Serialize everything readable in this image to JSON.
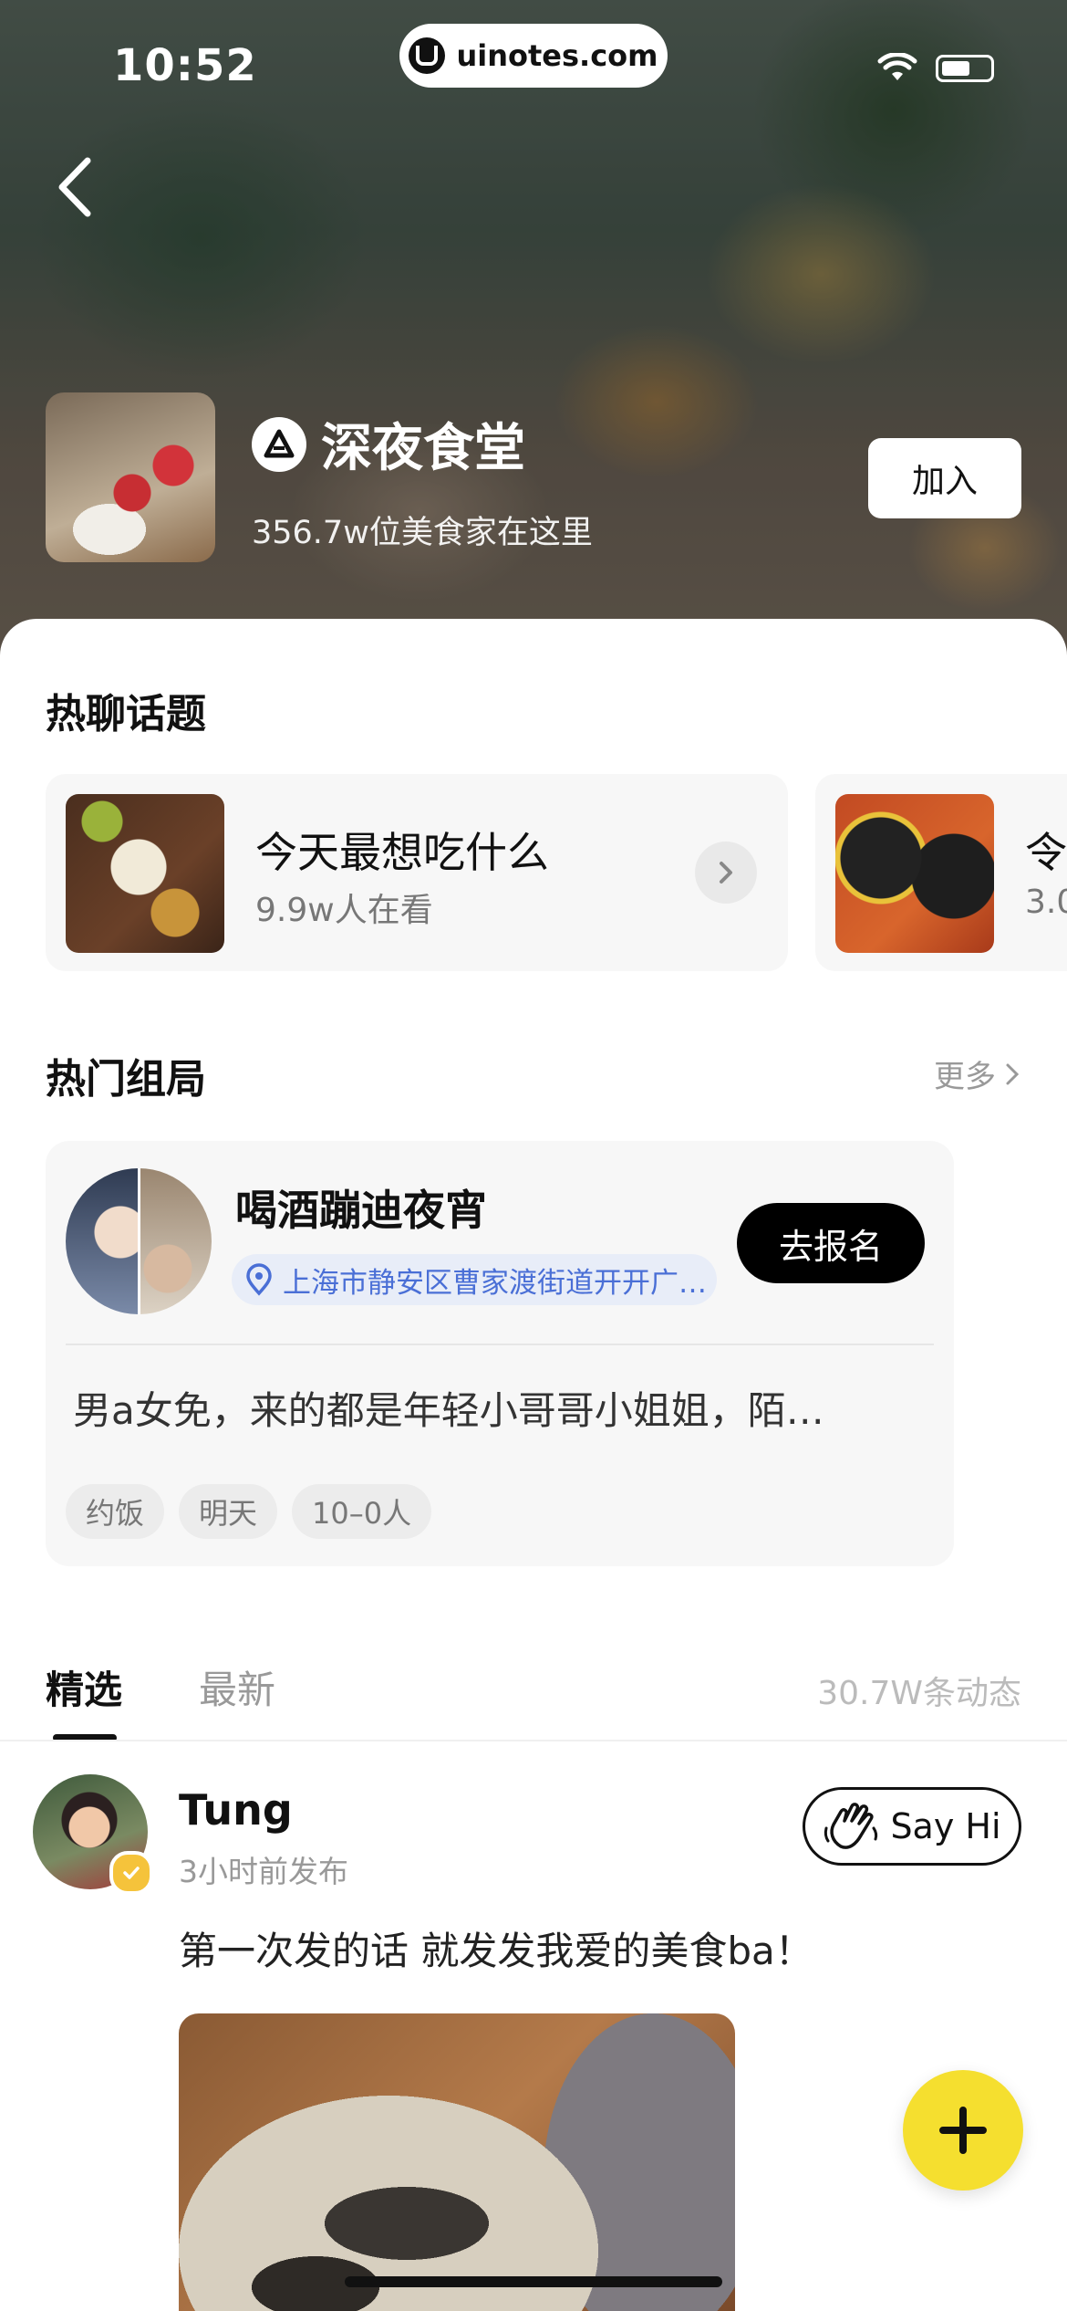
{
  "status_bar": {
    "time": "10:52",
    "url": "uinotes.com"
  },
  "group": {
    "name": "深夜食堂",
    "members_text": "356.7w位美食家在这里",
    "join_label": "加入"
  },
  "hot_topics": {
    "title": "热聊话题",
    "items": [
      {
        "title": "今天最想吃什么",
        "subtitle": "9.9w人在看"
      },
      {
        "title": "令",
        "subtitle": "3.0"
      }
    ]
  },
  "meetups": {
    "title": "热门组局",
    "more_label": "更多",
    "card": {
      "title": "喝酒蹦迪夜宵",
      "location": "上海市静安区曹家渡街道开开广…",
      "signup_label": "去报名",
      "description": "男a女免，来的都是年轻小哥哥小姐姐，陌…",
      "tags": [
        "约饭",
        "明天",
        "10–0人"
      ]
    }
  },
  "feed_tabs": {
    "tabs": [
      "精选",
      "最新"
    ],
    "active_tab": "精选",
    "post_count": "30.7W条动态"
  },
  "post": {
    "user": "Tung",
    "time": "3小时前发布",
    "text": "第一次发的话 就发发我爱的美食ba！",
    "say_hi_label": "Say Hi"
  },
  "colors": {
    "fab": "#f5df2f",
    "location_text": "#4a6fd6",
    "verified": "#f5c33b"
  },
  "icons": [
    "back-icon",
    "wifi-icon",
    "battery-icon",
    "group-logo-icon",
    "chevron-right-icon",
    "location-pin-icon",
    "wave-hand-icon",
    "plus-icon",
    "verified-icon"
  ]
}
